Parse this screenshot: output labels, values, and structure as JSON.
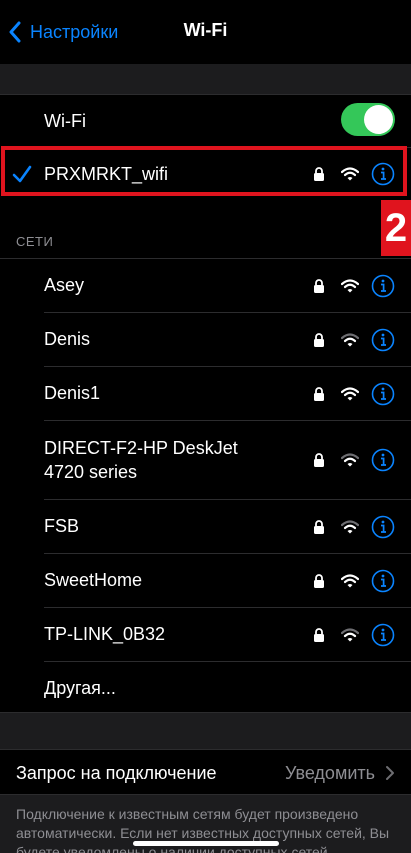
{
  "nav": {
    "back_label": "Настройки",
    "title": "Wi-Fi"
  },
  "wifi_toggle": {
    "label": "Wi-Fi",
    "enabled": true
  },
  "current_network": {
    "name": "PRXMRKT_wifi",
    "connected": true,
    "secured": true,
    "signal": "full"
  },
  "annotation": {
    "badge": "2",
    "color": "#e0141e"
  },
  "networks_section": {
    "header": "СЕТИ"
  },
  "networks": [
    {
      "name": "Asey",
      "secured": true,
      "signal": "full"
    },
    {
      "name": "Denis",
      "secured": true,
      "signal": "medium"
    },
    {
      "name": "Denis1",
      "secured": true,
      "signal": "full"
    },
    {
      "name_line1": "DIRECT-F2-HP DeskJet",
      "name_line2": "4720 series",
      "secured": true,
      "signal": "medium"
    },
    {
      "name": "FSB",
      "secured": true,
      "signal": "medium"
    },
    {
      "name": "SweetHome",
      "secured": true,
      "signal": "full"
    },
    {
      "name": "TP-LINK_0B32",
      "secured": true,
      "signal": "medium"
    }
  ],
  "other_label": "Другая...",
  "ask_to_join": {
    "label": "Запрос на подключение",
    "value": "Уведомить"
  },
  "footer_text": "Подключение к известным сетям будет произведено автоматически. Если нет известных доступных сетей, Вы будете уведомлены о наличии доступных сетей.",
  "colors": {
    "accent": "#0a84ff",
    "toggle_on": "#34c759",
    "highlight": "#e0141e",
    "secondary_text": "#8e8e93"
  }
}
